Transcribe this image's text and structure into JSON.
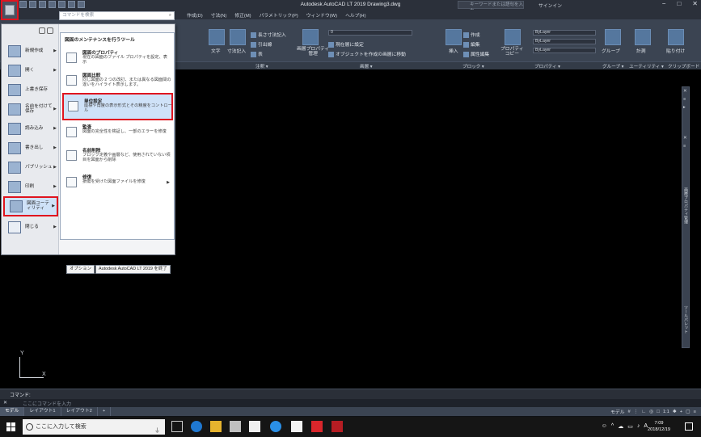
{
  "title": "Autodesk AutoCAD LT 2019   Drawing3.dwg",
  "titlebar": {
    "search_placeholder": "キーワードまたは語句を入力",
    "signin": "サインイン",
    "window_controls": [
      "−",
      "□",
      "✕"
    ]
  },
  "menubar": [
    "作成(D)",
    "寸法(N)",
    "修正(M)",
    "パラメトリック(P)",
    "ウィンドウ(W)",
    "ヘルプ(H)"
  ],
  "ribbon": {
    "text_label": "文字",
    "dimension_label": "寸法記入",
    "linear_label": "長さ寸法記入",
    "leader_label": "引出線",
    "table_label": "表",
    "layer_props_label": "画層プロパティ\n管理",
    "layer_current": "現在層に設定",
    "layer_match": "オブジェクトを作成の画層に移動",
    "insert_label": "挿入",
    "create_label": "作成",
    "edit_label": "編集",
    "attr_edit_label": "属性編集",
    "match_prop_label": "プロパティ\nコピー",
    "group_label": "グループ",
    "measure_label": "計測",
    "paste_label": "貼り付け",
    "bylayer": [
      "ByLayer",
      "ByLayer",
      "ByLayer"
    ],
    "panels": [
      "注釈 ▾",
      "画層 ▾",
      "ブロック ▾",
      "プロパティ ▾",
      "グループ ▾",
      "ユーティリティ ▾",
      "クリップボード"
    ],
    "layer_value": "0"
  },
  "appmenu": {
    "search_placeholder": "コマンドを検索",
    "left_items": [
      {
        "label": "新規作成",
        "icon": "new-icon"
      },
      {
        "label": "開く",
        "icon": "open-icon"
      },
      {
        "label": "上書き保存",
        "icon": "save-icon"
      },
      {
        "label": "名前を付けて保存",
        "icon": "saveas-icon"
      },
      {
        "label": "読み込み",
        "icon": "import-icon"
      },
      {
        "label": "書き出し",
        "icon": "export-icon"
      },
      {
        "label": "パブリッシュ",
        "icon": "publish-icon"
      },
      {
        "label": "印刷",
        "icon": "print-icon"
      },
      {
        "label": "図面ユーティリティ",
        "icon": "wrench-icon"
      },
      {
        "label": "閉じる",
        "icon": "close-icon"
      }
    ],
    "right_header": "図面のメンテナンスを行うツール",
    "right_items": [
      {
        "title": "図面のプロパティ",
        "desc": "現在の図面のファイル プロパティを設定、表示"
      },
      {
        "title": "図面比較",
        "desc": "同じ図面の 2 つの改訂、または異なる図面間の違いをハイライト表示します。"
      },
      {
        "title": "単位設定",
        "desc": "座標や角度の表示形式とその精度をコントロール"
      },
      {
        "title": "監査",
        "desc": "図面の完全性を検証し、一部のエラーを修復"
      },
      {
        "title": "名前削除",
        "desc": "ブロック定義や画層など、使用されていない項目を図面から削除"
      },
      {
        "title": "修復",
        "desc": "損傷を受けた図面ファイルを修復"
      }
    ],
    "options_button": "オプション",
    "exit_button": "Autodesk AutoCAD LT 2019 を終了"
  },
  "right_palette": [
    "✕",
    "≡",
    "▸",
    "✕",
    "≡",
    "画層プロパティ管理",
    "ツールパレット"
  ],
  "ucs": {
    "x": "X",
    "y": "Y"
  },
  "command": {
    "history": "コマンド:",
    "placeholder": "ここにコマンドを入力",
    "close": "✕"
  },
  "layout_tabs": [
    "モデル",
    "レイアウト1",
    "レイアウト2",
    "+"
  ],
  "status": {
    "model": "モデル",
    "scale": "1:1"
  },
  "taskbar": {
    "search": "ここに入力して検索",
    "time": "7:09",
    "date": "2018/12/19",
    "ime": "A"
  }
}
